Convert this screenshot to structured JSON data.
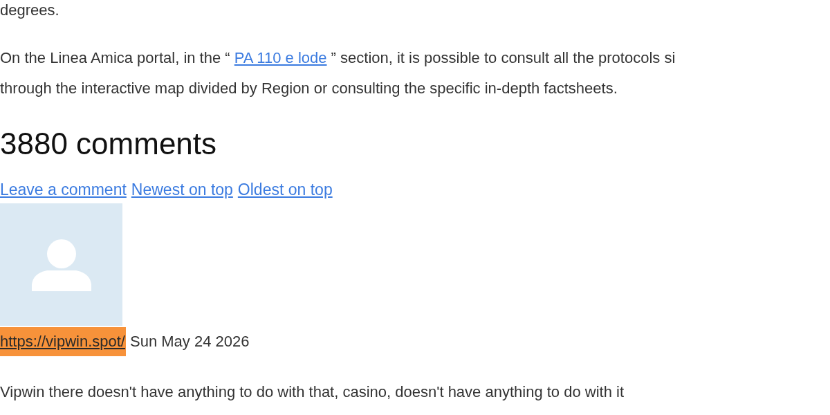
{
  "intro_fragment": "degrees.",
  "paragraph": {
    "text_before": "On the Linea Amica portal, in the “ ",
    "link": "PA 110 e lode",
    "text_after": " ” section, it is possible to consult all the protocols si",
    "continuation": "through the interactive map divided by Region or consulting the specific in-depth factsheets."
  },
  "comments_heading": "3880 comments",
  "comment_links": [
    "Leave a comment",
    "Newest on top",
    "Oldest on top"
  ],
  "comments": [
    {
      "author_link": "https://vipwin.spot/",
      "author_highlighted": true,
      "date": "Sun May 24 2026",
      "text": "Vipwin there doesn't have anything to do with that, casino, doesn't have anything to do with it"
    }
  ]
}
